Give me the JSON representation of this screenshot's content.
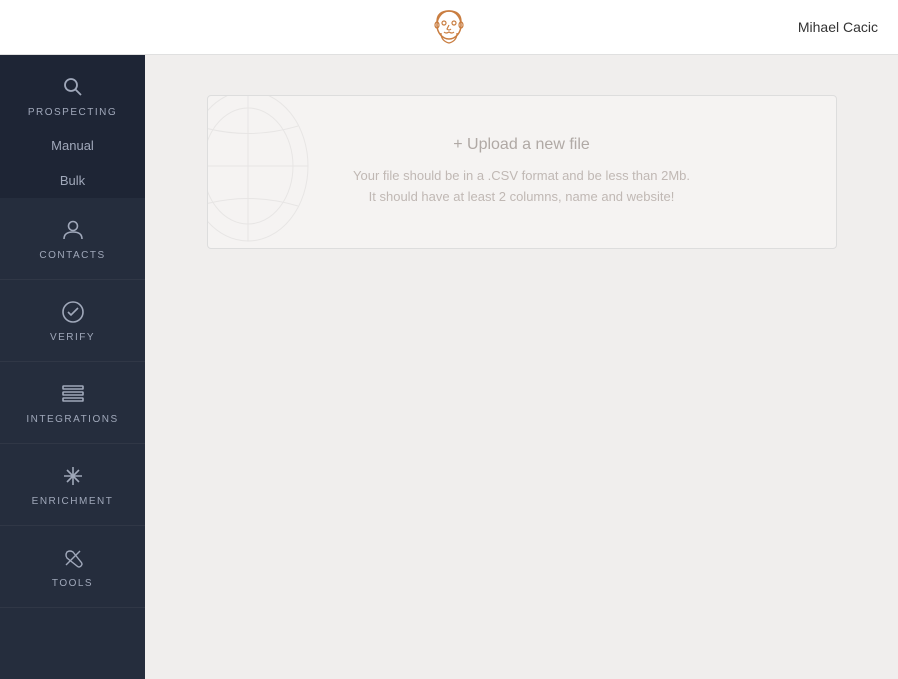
{
  "header": {
    "user_name": "Mihael Cacic"
  },
  "sidebar": {
    "items": [
      {
        "id": "prospecting",
        "label": "PROSPECTING",
        "active": true,
        "subitems": [
          "Manual",
          "Bulk"
        ]
      },
      {
        "id": "contacts",
        "label": "CONTACTS",
        "active": false
      },
      {
        "id": "verify",
        "label": "VERIFY",
        "active": false
      },
      {
        "id": "integrations",
        "label": "INTEGRATIONS",
        "active": false
      },
      {
        "id": "enrichment",
        "label": "ENRICHMENT",
        "active": false
      },
      {
        "id": "tools",
        "label": "TOOLS",
        "active": false
      }
    ]
  },
  "main": {
    "upload": {
      "title": "+ Upload a new file",
      "desc_line1": "Your file should be in a .CSV format and be less than 2Mb.",
      "desc_line2": "It should have at least 2 columns, name and website!"
    }
  }
}
